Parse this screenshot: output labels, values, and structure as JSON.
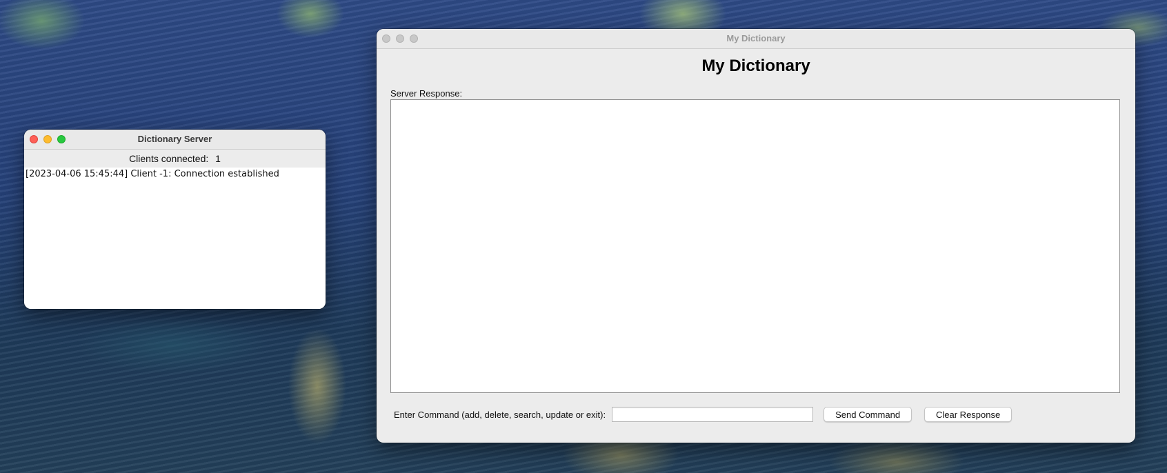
{
  "server_window": {
    "title": "Dictionary Server",
    "clients_label": "Clients connected:",
    "clients_count": "1",
    "log": [
      "[2023-04-06 15:45:44] Client -1: Connection established"
    ]
  },
  "dictionary_window": {
    "title": "My Dictionary",
    "heading": "My Dictionary",
    "response_label": "Server Response:",
    "response_text": "",
    "command_label": "Enter Command (add, delete, search, update or exit):",
    "command_value": "",
    "send_label": "Send Command",
    "clear_label": "Clear Response"
  },
  "colors": {
    "close": "#fe5f57",
    "minimize": "#febc2e",
    "maximize": "#28c840",
    "inactive_dot": "#c8c8c8"
  },
  "icons": [
    "close-icon",
    "minimize-icon",
    "maximize-icon"
  ]
}
